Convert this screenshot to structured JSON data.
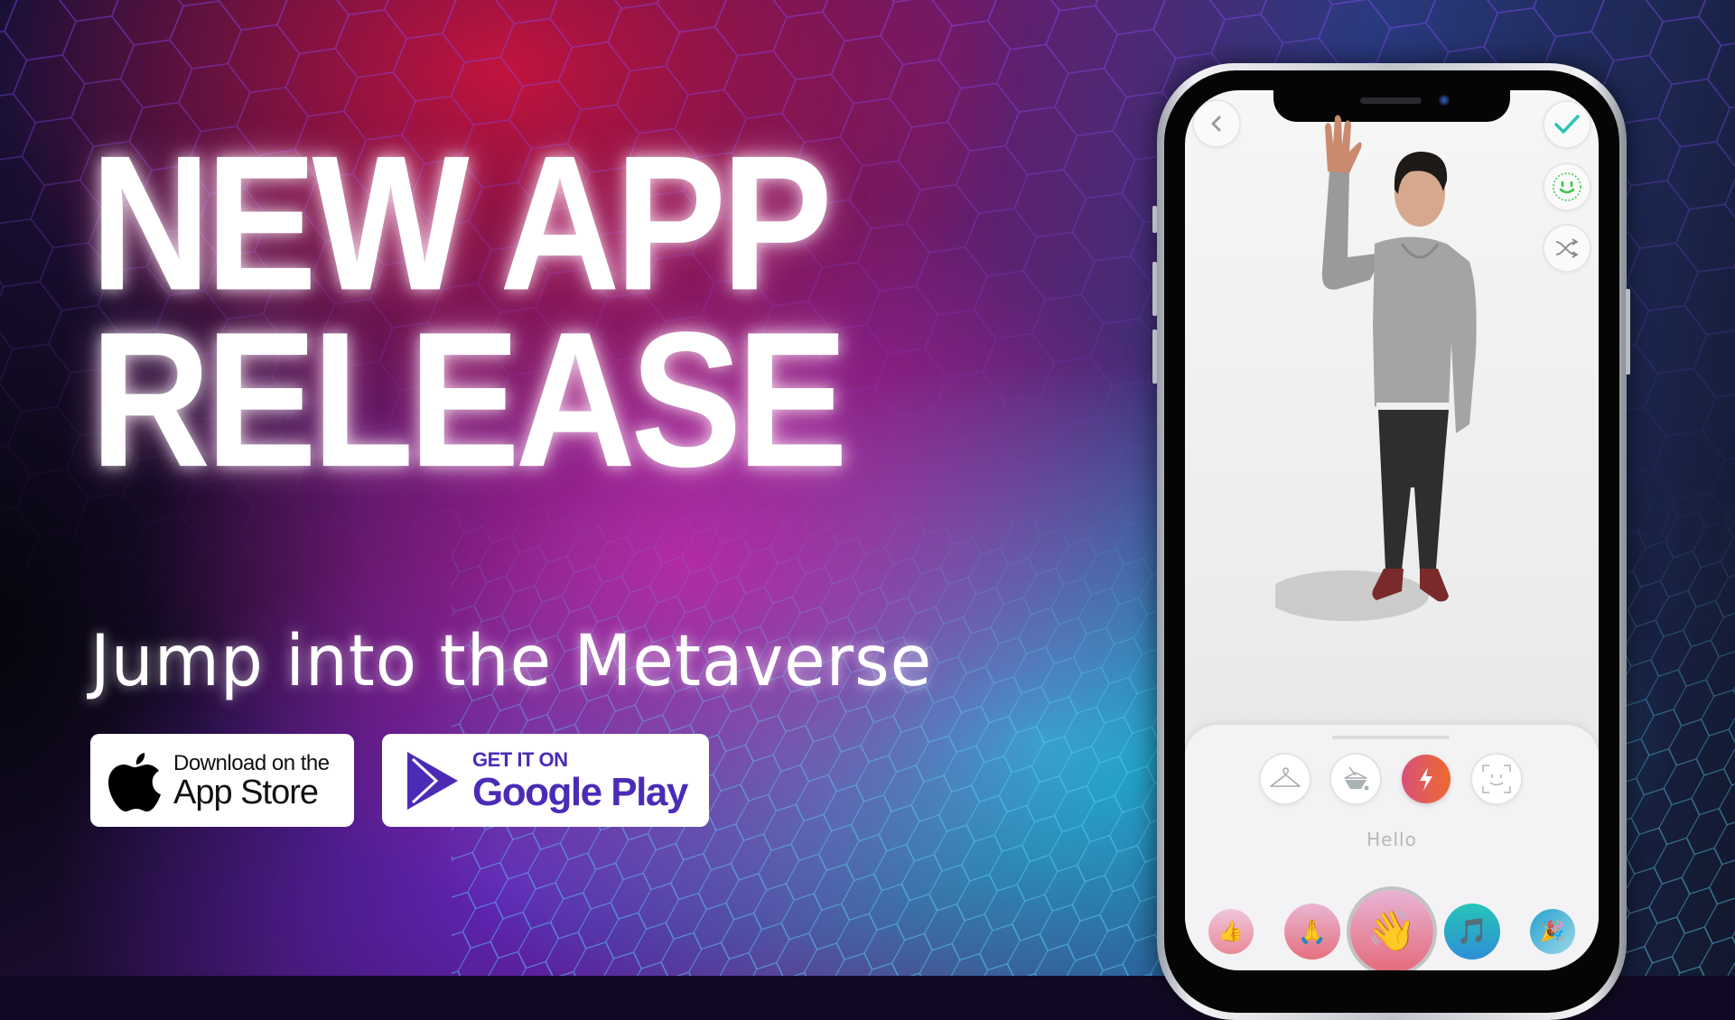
{
  "headline": {
    "line1": "NEW APP",
    "line2": "RELEASE"
  },
  "subtitle": "Jump into the Metaverse",
  "badges": {
    "app_store": {
      "small": "Download on the",
      "big": "App Store",
      "icon": "apple-icon"
    },
    "google_play": {
      "small": "GET IT ON",
      "big": "Google Play",
      "icon": "play-triangle-icon",
      "color": "#4b2bb6"
    }
  },
  "phone": {
    "top_left_button": {
      "icon": "back-chevron-icon"
    },
    "right_buttons": [
      {
        "icon": "checkmark-icon",
        "color": "#2ec4b6"
      },
      {
        "icon": "face-scan-smile-icon",
        "color": "#3cc44a"
      },
      {
        "icon": "shuffle-icon"
      }
    ],
    "panel": {
      "tools": [
        {
          "icon": "hanger-icon",
          "active": false
        },
        {
          "icon": "paint-bucket-icon",
          "active": false
        },
        {
          "icon": "lightning-icon",
          "active": true
        },
        {
          "icon": "face-frame-icon",
          "active": false
        }
      ],
      "selected_label": "Hello",
      "emotes": [
        {
          "glyph": "👍",
          "name": "thumbs-up"
        },
        {
          "glyph": "🙏",
          "name": "folded-hands"
        },
        {
          "glyph": "👋",
          "name": "waving-hand",
          "selected": true
        },
        {
          "glyph": "🎵",
          "name": "music-note"
        },
        {
          "glyph": "🎉",
          "name": "party-popper"
        }
      ]
    }
  }
}
